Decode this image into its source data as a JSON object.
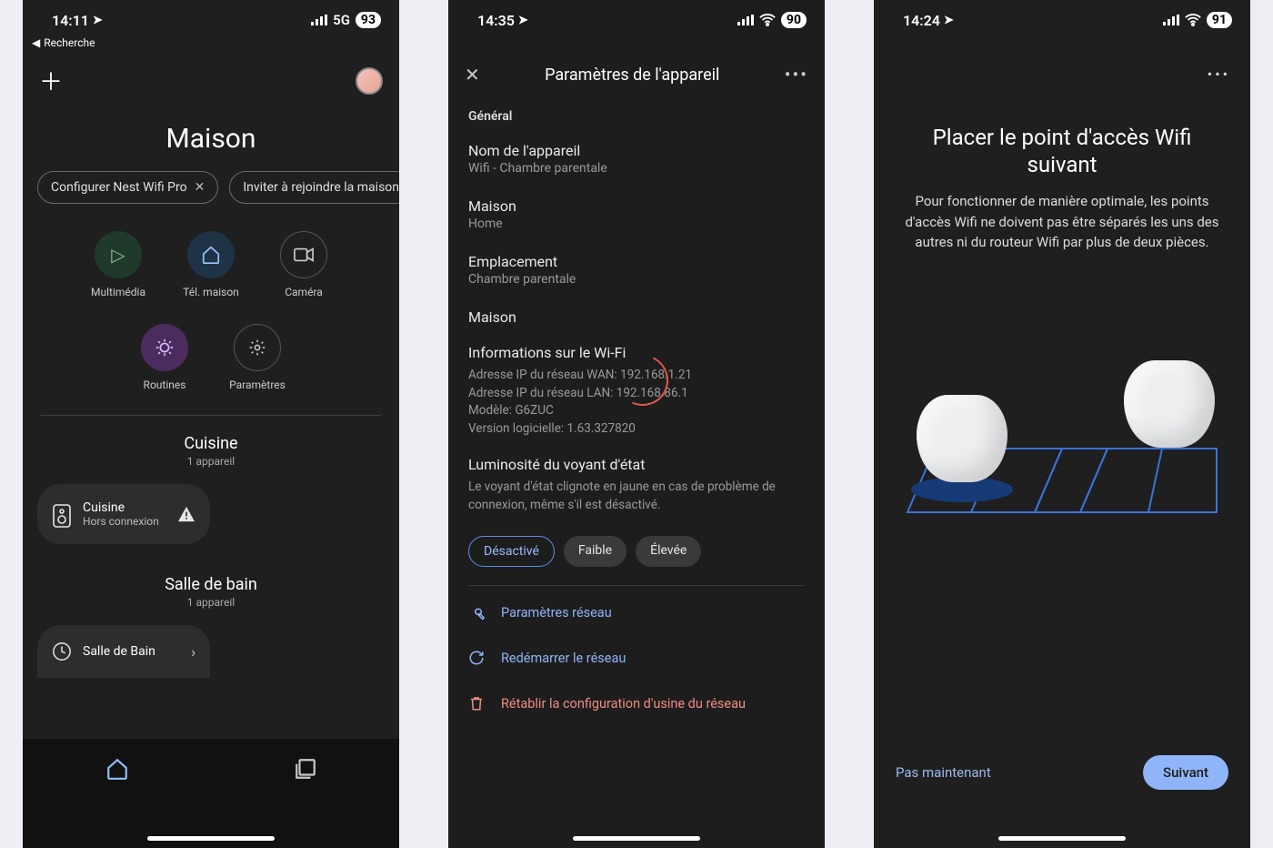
{
  "screen1": {
    "status": {
      "time": "14:11",
      "net": "5G",
      "battery": "93",
      "back": "Recherche"
    },
    "title": "Maison",
    "chips": [
      {
        "label": "Configurer Nest Wifi Pro",
        "closable": true
      },
      {
        "label": "Inviter à rejoindre la maison",
        "closable": true
      }
    ],
    "actions": [
      {
        "label": "Multimédia",
        "variant": "green"
      },
      {
        "label": "Tél. maison",
        "variant": "blue"
      },
      {
        "label": "Caméra",
        "variant": "plain"
      },
      {
        "label": "Routines",
        "variant": "purple"
      },
      {
        "label": "Paramètres",
        "variant": "plain"
      }
    ],
    "rooms": [
      {
        "name": "Cuisine",
        "count": "1 appareil",
        "card": {
          "title": "Cuisine",
          "sub": "Hors connexion",
          "warn": true
        }
      },
      {
        "name": "Salle de bain",
        "count": "1 appareil",
        "card": {
          "title": "Salle de Bain",
          "sub": "",
          "chevron": true
        }
      }
    ]
  },
  "screen2": {
    "status": {
      "time": "14:35",
      "battery": "90"
    },
    "title": "Paramètres de l'appareil",
    "section": "Général",
    "items": {
      "name": {
        "label": "Nom de l'appareil",
        "value": "Wifi - Chambre parentale"
      },
      "maison": {
        "label": "Maison",
        "value": "Home"
      },
      "location": {
        "label": "Emplacement",
        "value": "Chambre parentale"
      },
      "maison2": {
        "label": "Maison"
      }
    },
    "wifi": {
      "heading": "Informations sur le Wi-Fi",
      "lines": {
        "wan": "Adresse IP du réseau WAN: 192.168.1.21",
        "lan": "Adresse IP du réseau LAN: 192.168.86.1",
        "model": "Modèle: G6ZUC",
        "sw": "Version logicielle: 1.63.327820"
      }
    },
    "led": {
      "heading": "Luminosité du voyant d'état",
      "desc": "Le voyant d'état clignote en jaune en cas de problème de connexion, même s'il est désactivé.",
      "options": {
        "off": "Désactivé",
        "low": "Faible",
        "high": "Élevée"
      },
      "selected": "off"
    },
    "links": {
      "network": "Paramètres réseau",
      "restart": "Redémarrer le réseau",
      "reset": "Rétablir la configuration d'usine du réseau"
    }
  },
  "screen3": {
    "status": {
      "time": "14:24",
      "battery": "91"
    },
    "title": "Placer le point d'accès Wifi suivant",
    "body": "Pour fonctionner de manière optimale, les points d'accès Wifi ne doivent pas être séparés les uns des autres ni du routeur Wifi par plus de deux pièces.",
    "later": "Pas maintenant",
    "next": "Suivant"
  }
}
